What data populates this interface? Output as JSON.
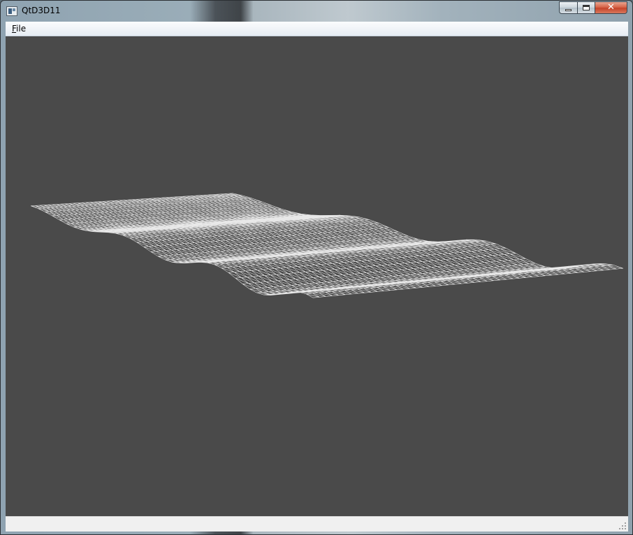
{
  "window": {
    "title": "QtD3D11",
    "icon": "app-window-icon",
    "caption_buttons": [
      {
        "name": "minimize-button",
        "icon": "minimize-icon"
      },
      {
        "name": "maximize-button",
        "icon": "maximize-icon"
      },
      {
        "name": "close-button",
        "icon": "close-icon",
        "glyph": "✕"
      }
    ]
  },
  "menubar": {
    "items": [
      {
        "mnemonic": "F",
        "rest": "ile"
      }
    ]
  },
  "viewport": {
    "background": "#4a4a4a",
    "wire_color": "#e8e8e8",
    "content": "sine-wave-wireframe-mesh"
  },
  "statusbar": {
    "text": ""
  }
}
